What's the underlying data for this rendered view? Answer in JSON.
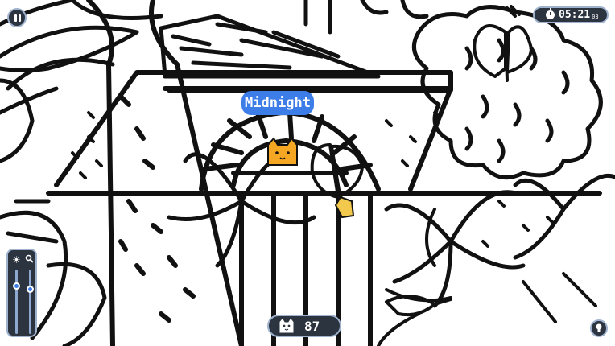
{
  "hud": {
    "timer": {
      "main": "05:21",
      "fraction": "03"
    },
    "found_cat_name": "Midnight",
    "cats_remaining": "87",
    "brightness_level": 0.75,
    "zoom_level": 0.7
  },
  "icons": {
    "pause": "pause-icon",
    "timer": "stopwatch-icon",
    "brightness": "sun-icon",
    "zoom": "magnifier-icon",
    "counter": "cat-head-icon",
    "hint": "lightbulb-icon"
  },
  "colors": {
    "hud_background": "#2c3440",
    "hud_border": "#9fb3cf",
    "accent_blue": "#3d7de8",
    "found_cat": "#f5a623",
    "line_art": "#111111"
  }
}
